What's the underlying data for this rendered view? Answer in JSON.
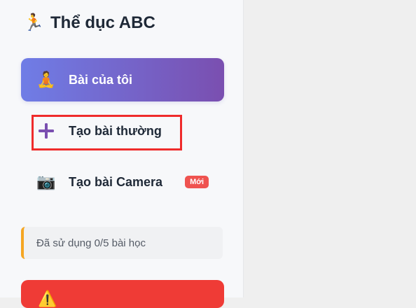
{
  "app": {
    "title": "Thể dục ABC",
    "logo_icon": "🏃"
  },
  "nav": {
    "items": [
      {
        "label": "Bài của tôi",
        "icon": "🧘",
        "icon_name": "meditation-icon",
        "active": true
      },
      {
        "label": "Tạo bài thường",
        "icon": "➕",
        "icon_name": "plus-icon",
        "active": false
      },
      {
        "label": "Tạo bài Camera",
        "icon": "📷",
        "icon_name": "camera-icon",
        "active": false,
        "badge": "Mới"
      }
    ]
  },
  "usage": {
    "text": "Đã sử dụng 0/5 bài học"
  },
  "bottom_card": {
    "icon": "⚠️",
    "icon_name": "warning-icon"
  },
  "colors": {
    "active_gradient_start": "#6f7de6",
    "active_gradient_end": "#7a4fb0",
    "plus_icon": "#7a4fb0",
    "badge_bg": "#ef5350",
    "highlight": "#ef2b2b",
    "usage_accent": "#f5a623",
    "bottom_card_bg": "#ef3b36"
  }
}
